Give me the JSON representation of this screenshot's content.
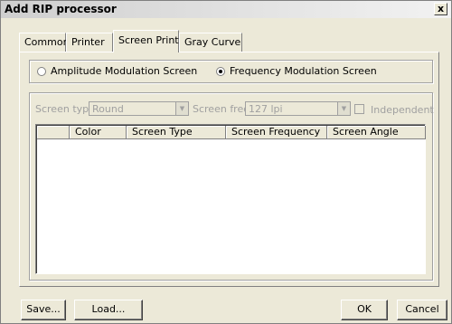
{
  "window": {
    "title": "Add RIP processor",
    "close_glyph": "x"
  },
  "tabs": [
    {
      "label": "Common"
    },
    {
      "label": "Printer"
    },
    {
      "label": "Screen Print"
    },
    {
      "label": "Gray Curve"
    }
  ],
  "active_tab": "Screen Print",
  "modulation": {
    "amplitude_label": "Amplitude Modulation Screen",
    "frequency_label": "Frequency Modulation Screen",
    "selected": "Frequency Modulation Screen"
  },
  "screen_settings": {
    "type_label": "Screen type:",
    "type_value": "Round",
    "freq_label": "Screen freq:",
    "freq_value": "127 lpi",
    "independent_label": "Independent",
    "independent_checked": false,
    "enabled": false
  },
  "table": {
    "columns": [
      "",
      "Color",
      "Screen Type",
      "Screen Frequency",
      "Screen Angle"
    ],
    "rows": []
  },
  "buttons": {
    "save": "Save...",
    "load": "Load...",
    "ok": "OK",
    "cancel": "Cancel"
  }
}
